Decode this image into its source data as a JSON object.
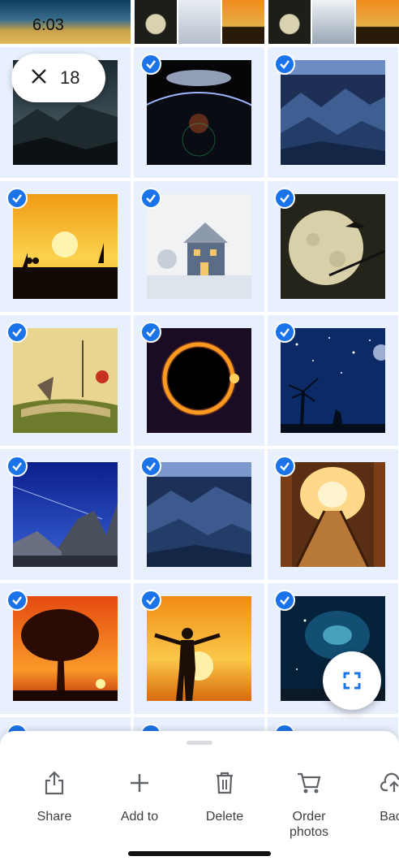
{
  "status": {
    "time": "6:03"
  },
  "selection": {
    "count": "18"
  },
  "actions": [
    {
      "label": "Share",
      "icon": "share-icon"
    },
    {
      "label": "Add to",
      "icon": "plus-icon"
    },
    {
      "label": "Delete",
      "icon": "trash-icon"
    },
    {
      "label": "Order\nphotos",
      "icon": "cart-icon"
    },
    {
      "label": "Back",
      "icon": "cloud-upload-icon"
    }
  ],
  "colors": {
    "accent": "#1a73e8",
    "selectedCell": "#e8f0fe"
  },
  "photos": [
    {
      "name": "rocky-night-landscape"
    },
    {
      "name": "planet-horizon"
    },
    {
      "name": "blue-mountains"
    },
    {
      "name": "sunset-sailboats"
    },
    {
      "name": "snowy-house"
    },
    {
      "name": "full-moon-bats"
    },
    {
      "name": "open-book-fantasy"
    },
    {
      "name": "solar-eclipse"
    },
    {
      "name": "starry-night-wolf"
    },
    {
      "name": "blue-sky-mountains"
    },
    {
      "name": "misty-blue-mountains"
    },
    {
      "name": "golden-bridge"
    },
    {
      "name": "sunset-tree"
    },
    {
      "name": "man-at-sunset"
    },
    {
      "name": "blue-nebula"
    }
  ]
}
